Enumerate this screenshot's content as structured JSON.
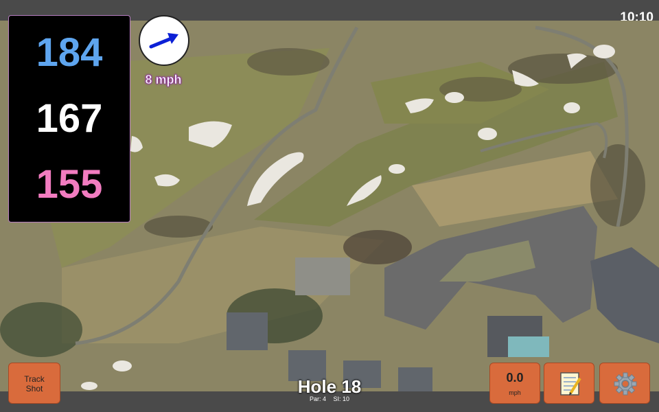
{
  "clock": "10:10",
  "yardages": {
    "back": "184",
    "middle": "167",
    "front": "155"
  },
  "wind": {
    "speed": "8 mph",
    "direction_icon": "arrow-right-icon"
  },
  "buttons": {
    "track_shot_line1": "Track",
    "track_shot_line2": "Shot",
    "speed_value": "0.0",
    "speed_unit": "mph",
    "notes_icon": "notepad-icon",
    "settings_icon": "gear-icon"
  },
  "hole": {
    "title": "Hole 18",
    "par": "Par: 4",
    "si": "SI: 10"
  },
  "colors": {
    "back": "#5ea5ef",
    "middle": "#ffffff",
    "front": "#f27cc0",
    "button": "#d96b3c"
  }
}
